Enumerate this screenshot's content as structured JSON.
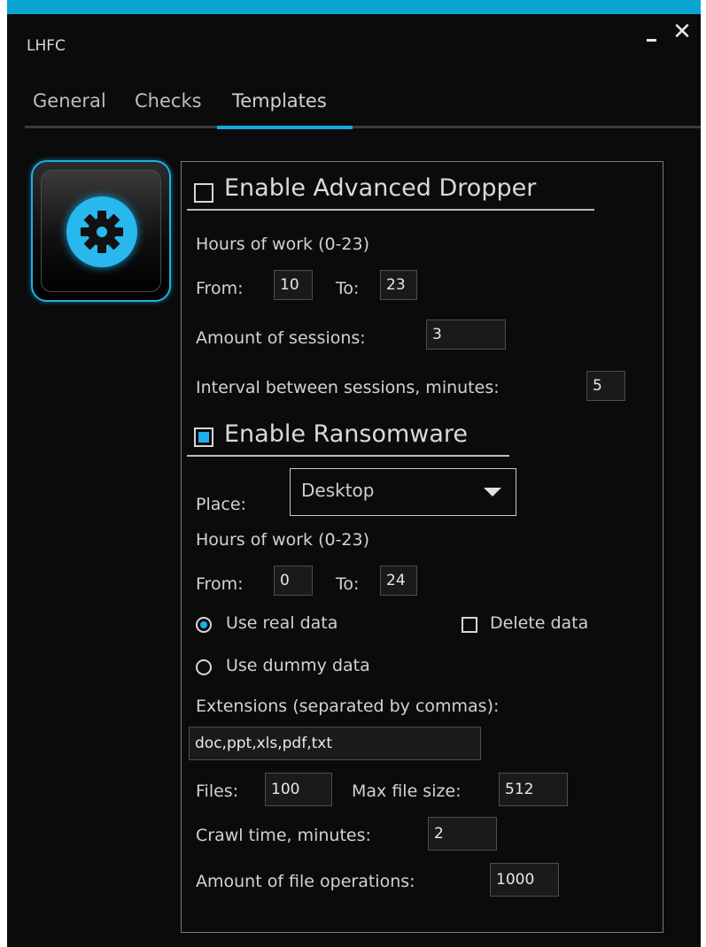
{
  "window": {
    "title": "LHFC",
    "close_glyph": "✕"
  },
  "tabs": [
    {
      "label": "General",
      "active": false
    },
    {
      "label": "Checks",
      "active": false
    },
    {
      "label": "Templates",
      "active": true
    }
  ],
  "colors": {
    "accent": "#16a9df",
    "background": "#0b0b0b",
    "text": "#d2d2d2"
  },
  "sidebar": {
    "gear_icon": "gear-icon"
  },
  "dropper": {
    "enabled": false,
    "title": "Enable Advanced Dropper",
    "hours_label": "Hours of work (0-23)",
    "from_label": "From:",
    "from_value": "10",
    "to_label": "To:",
    "to_value": "23",
    "sessions_label": "Amount of sessions:",
    "sessions_value": "3",
    "interval_label": "Interval between sessions, minutes:",
    "interval_value": "5"
  },
  "ransomware": {
    "enabled": true,
    "title": "Enable Ransomware",
    "place_label": "Place:",
    "place_value": "Desktop",
    "hours_label": "Hours of work (0-23)",
    "from_label": "From:",
    "from_value": "0",
    "to_label": "To:",
    "to_value": "24",
    "use_real_label": "Use real data",
    "use_real_selected": true,
    "delete_label": "Delete data",
    "delete_checked": false,
    "use_dummy_label": "Use dummy data",
    "use_dummy_selected": false,
    "extensions_label": "Extensions (separated by commas):",
    "extensions_value": "doc,ppt,xls,pdf,txt",
    "files_label": "Files:",
    "files_value": "100",
    "maxsize_label": "Max file size:",
    "maxsize_value": "512",
    "crawl_label": "Crawl time, minutes:",
    "crawl_value": "2",
    "fileops_label": "Amount of file operations:",
    "fileops_value": "1000"
  }
}
